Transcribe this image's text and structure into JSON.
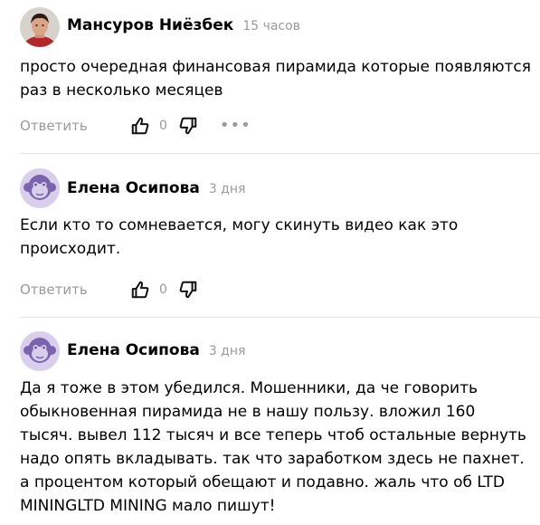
{
  "comments": [
    {
      "author": "Мансуров Ниёзбек",
      "time": "15 часов",
      "avatar_icon": "user-photo",
      "text": "просто очередная финансовая пирамида которые появляются раз в несколько месяцев",
      "reply_label": "Ответить",
      "likes": "0",
      "has_more": true
    },
    {
      "author": "Елена Осипова",
      "time": "3 дня",
      "avatar_icon": "monkey-avatar",
      "text": "Если кто то сомневается, могу скинуть видео как это происходит.",
      "reply_label": "Ответить",
      "likes": "0"
    },
    {
      "author": "Елена Осипова",
      "time": "3 дня",
      "avatar_icon": "monkey-avatar",
      "text": "Да я тоже в этом убедился. Мошенники, да че говорить обыкновенная пирамида не в нашу пользу. вложил 160 тысяч. вывел 112 тысяч и все теперь чтоб остальные вернуть надо опять вкладывать. так что заработком здесь не пахнет. а процентом который обещают и подавно. жаль что об LTD MININGLTD MINING мало пишут!"
    }
  ],
  "colors": {
    "muted": "#9a9a9a",
    "divider": "#e6e6e6",
    "monkey_bg": "#d9cfec",
    "monkey_fg": "#7c63ae"
  }
}
